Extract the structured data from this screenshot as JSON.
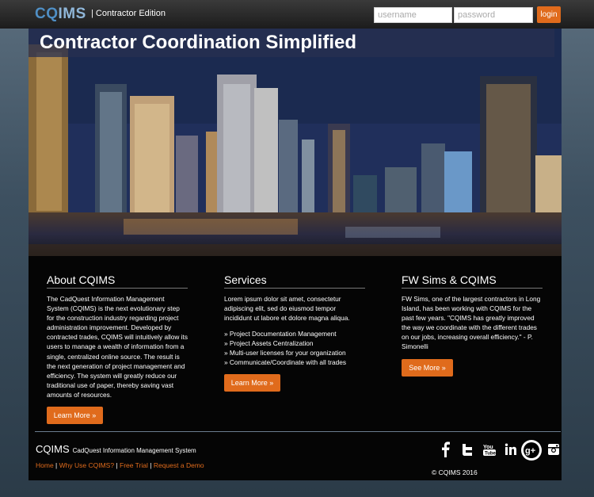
{
  "header": {
    "logo_cq": "CQ",
    "logo_ims": "IMS",
    "edition": "| Contractor Edition",
    "username_placeholder": "username",
    "password_placeholder": "password",
    "login_label": "login"
  },
  "hero": {
    "title": "Contractor Coordination Simplified"
  },
  "columns": {
    "about": {
      "heading": "About CQIMS",
      "body": "The CadQuest Information Management System (CQIMS) is the next evolutionary step for the construction industry regarding project administration improvement. Developed by contracted trades, CQIMS will intuitively allow its users to manage a wealth of information from a single, centralized online source. The result is the next generation of project management and efficiency. The system will greatly reduce our traditional use of paper, thereby saving vast amounts of resources.",
      "button": "Learn More »"
    },
    "services": {
      "heading": "Services",
      "body": "Lorem ipsum dolor sit amet, consectetur adipiscing elit, sed do eiusmod tempor incididunt ut labore et dolore magna aliqua.",
      "items": [
        "» Project Documentation Management",
        "» Project Assets Centralization",
        "» Multi-user licenses for your organization",
        "» Communicate/Coordinate with all trades"
      ],
      "button": "Learn More »"
    },
    "testimonial": {
      "heading": "FW Sims & CQIMS",
      "body": "FW Sims, one of the largest contractors in Long Island, has been working with CQIMS for the past few years. \"CQIMS has greatly improved the way we coordinate with the different trades on our jobs, increasing overall efficiency.\" - P. Simonelli",
      "button": "See More »"
    }
  },
  "footer": {
    "brand": "CQIMS",
    "brand_sub": "CadQuest Information Management System",
    "links": [
      "Home",
      "Why Use CQIMS?",
      "Free Trial",
      "Request a Demo"
    ],
    "copyright": "© CQIMS 2016",
    "social": [
      "facebook-icon",
      "twitter-icon",
      "youtube-icon",
      "linkedin-icon",
      "googleplus-icon",
      "instagram-icon"
    ]
  },
  "colors": {
    "accent": "#e06b1c",
    "logo_blue": "#4f8fc5",
    "content_bg": "#050505"
  }
}
